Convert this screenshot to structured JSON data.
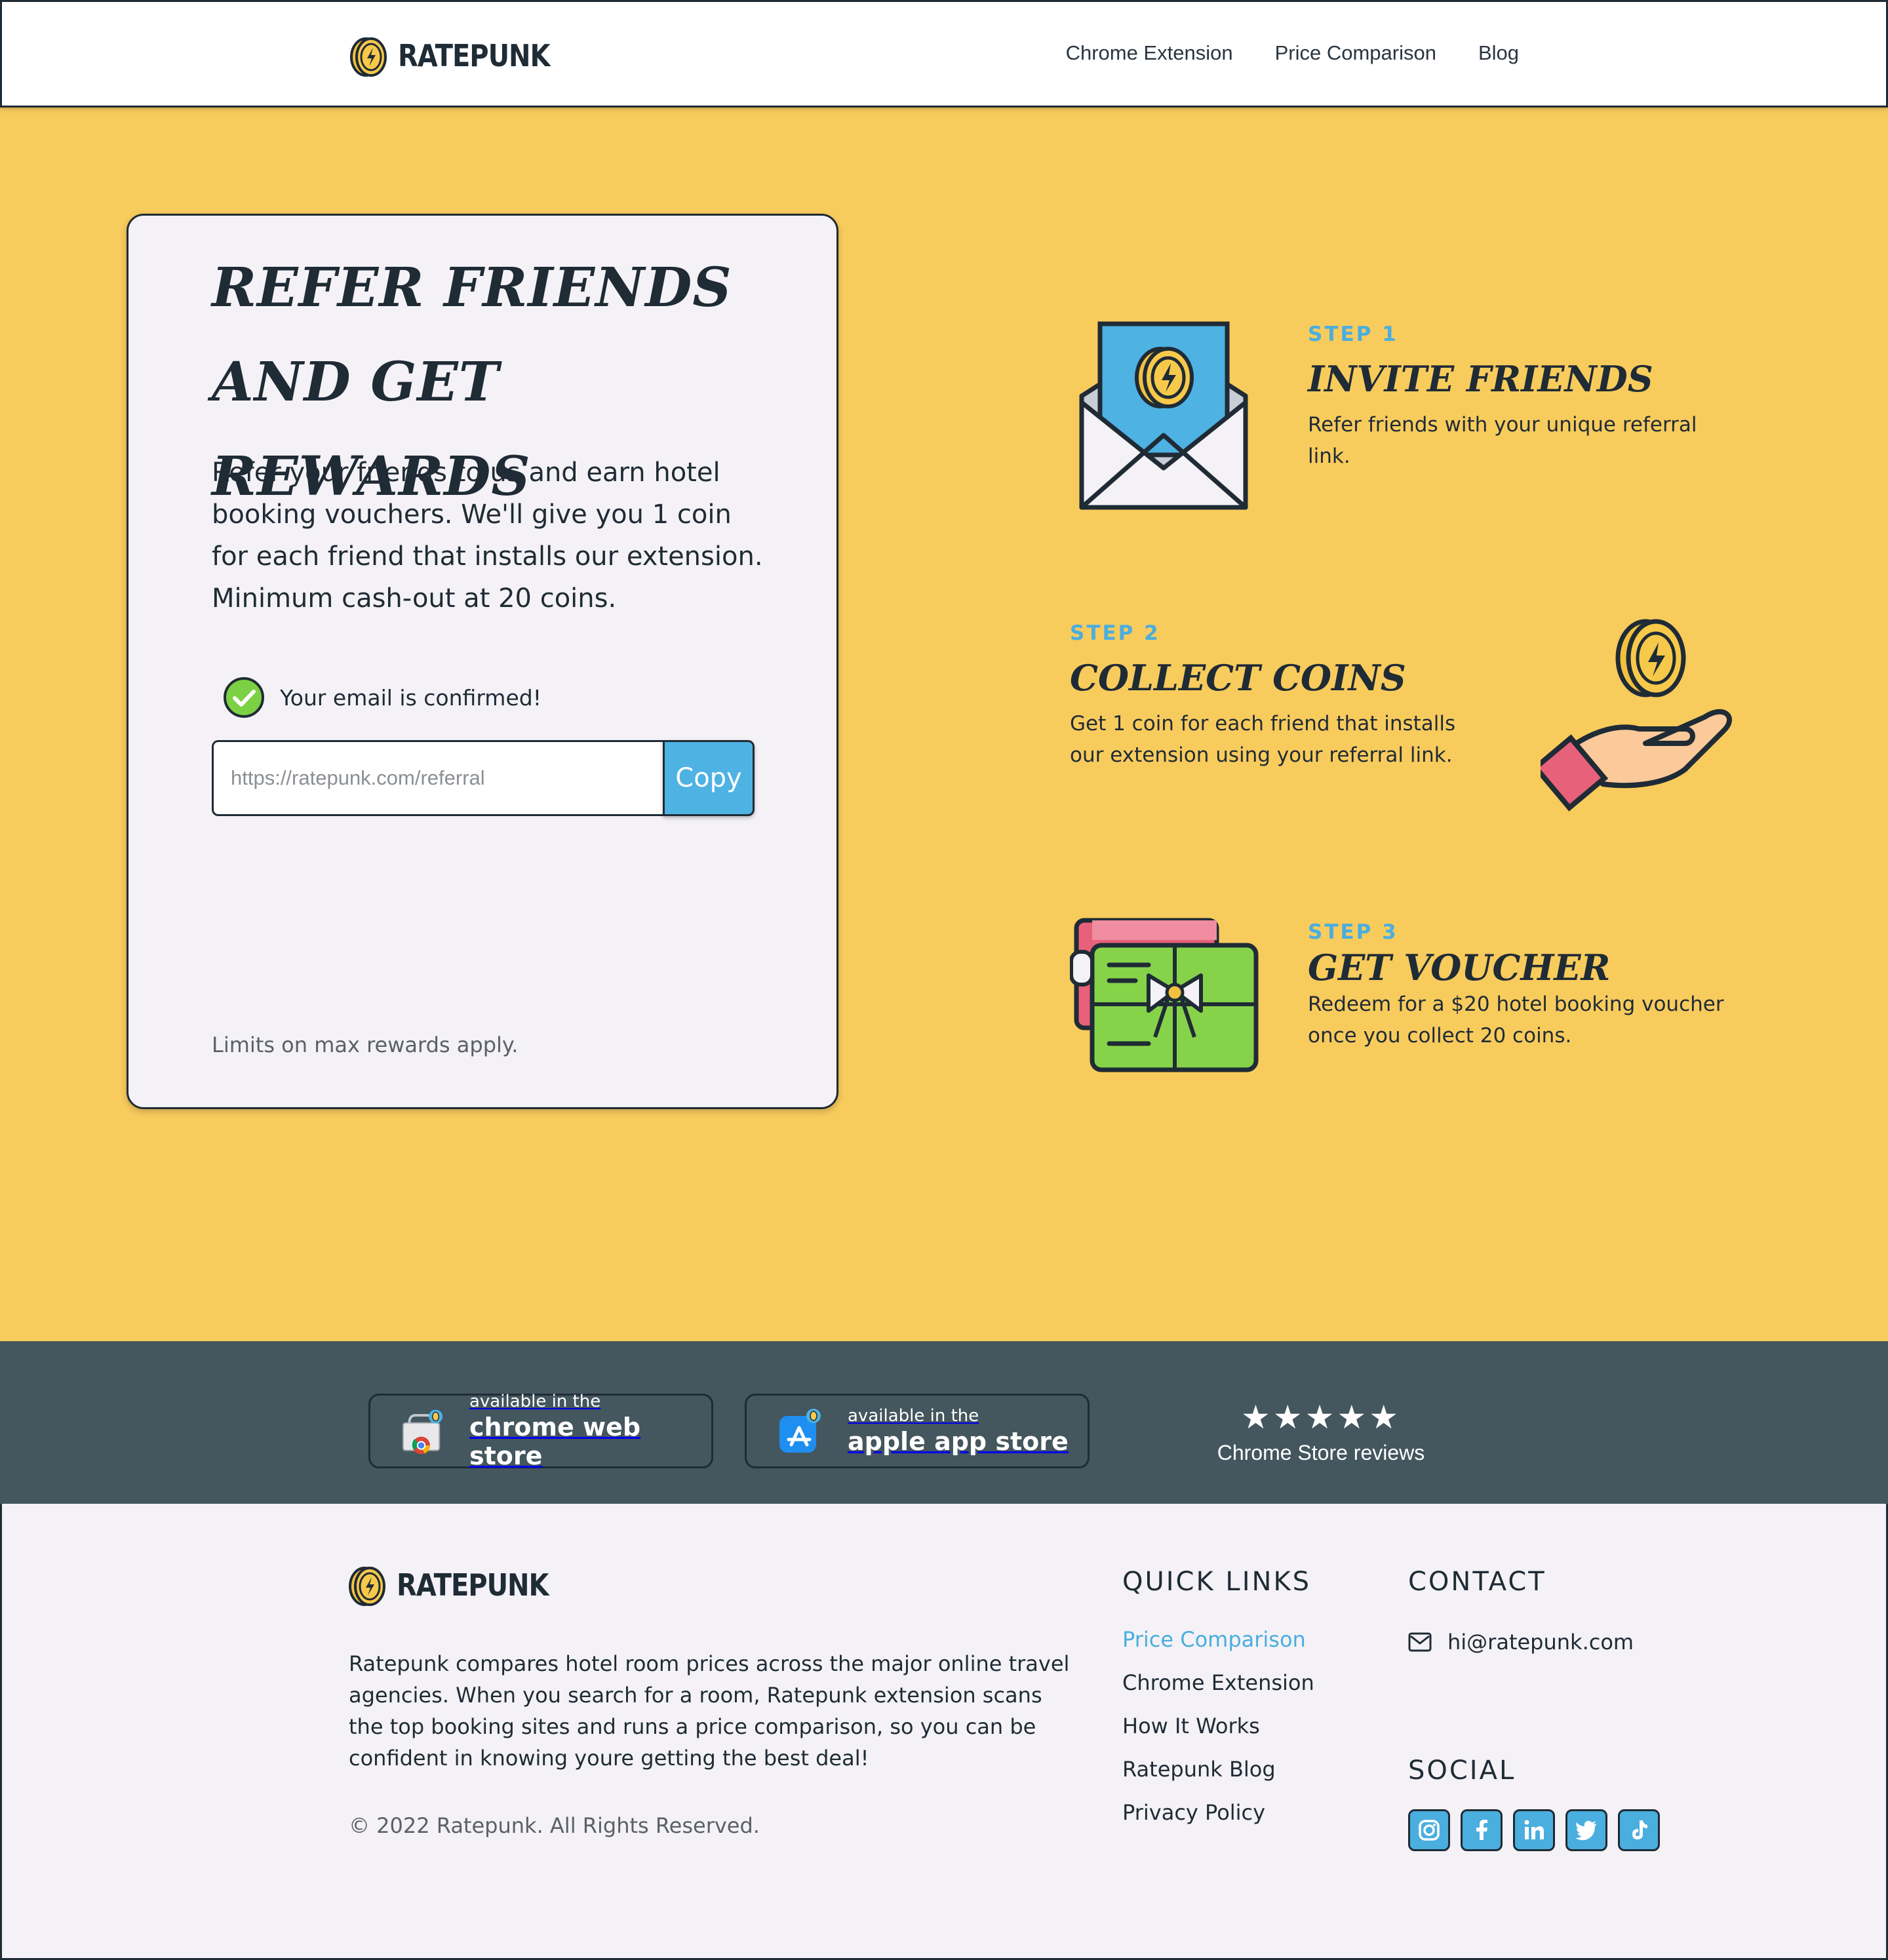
{
  "header": {
    "brand": "RATEPUNK",
    "nav": [
      "Chrome Extension",
      "Price Comparison",
      "Blog"
    ]
  },
  "referral_card": {
    "title": "REFER FRIENDS AND GET REWARDS",
    "description": "Refer your friends to us and earn hotel booking vouchers. We'll give you 1 coin for each friend that installs our extension. Minimum cash-out at 20 coins.",
    "confirmation": "Your email is confirmed!",
    "referral_placeholder": "https://ratepunk.com/referral",
    "copy_label": "Copy",
    "limits_note": "Limits on max rewards apply."
  },
  "steps": [
    {
      "label": "STEP 1",
      "title": "INVITE FRIENDS",
      "text": "Refer friends with your unique referral link.",
      "icon": "envelope-coin-icon"
    },
    {
      "label": "STEP 2",
      "title": "COLLECT COINS",
      "text": "Get 1 coin for each friend that installs our extension using your referral link.",
      "icon": "hand-coin-icon"
    },
    {
      "label": "STEP 3",
      "title": "GET VOUCHER",
      "text": "Redeem for a $20 hotel booking voucher once you collect 20 coins.",
      "icon": "gift-voucher-icon"
    }
  ],
  "stores": {
    "chrome": {
      "small": "available in the",
      "big": "chrome web store",
      "icon": "chrome-store-icon"
    },
    "apple": {
      "small": "available in the",
      "big": "apple app store",
      "icon": "app-store-icon"
    },
    "reviews": {
      "stars": "★★★★★",
      "rating_stars": 5,
      "label": "Chrome Store reviews"
    }
  },
  "footer": {
    "brand": "RATEPUNK",
    "about": "Ratepunk compares hotel room prices across the major online travel agencies. When you search for a room, Ratepunk extension scans the top booking sites and runs a price comparison, so you can be confident in knowing youre getting the best deal!",
    "copyright": "© 2022 Ratepunk. All Rights Reserved.",
    "quick_links_heading": "QUICK LINKS",
    "quick_links": [
      "Price Comparison",
      "Chrome Extension",
      "How It Works",
      "Ratepunk Blog",
      "Privacy Policy"
    ],
    "contact_heading": "CONTACT",
    "email": "hi@ratepunk.com",
    "social_heading": "SOCIAL",
    "social": [
      "instagram-icon",
      "facebook-icon",
      "linkedin-icon",
      "twitter-icon",
      "tiktok-icon"
    ]
  },
  "colors": {
    "hero_bg": "#f8cb5d",
    "accent_blue": "#4aaede",
    "dark": "#1f2b35",
    "storebar_bg": "#44565e",
    "footer_bg": "#f4f2f6"
  }
}
